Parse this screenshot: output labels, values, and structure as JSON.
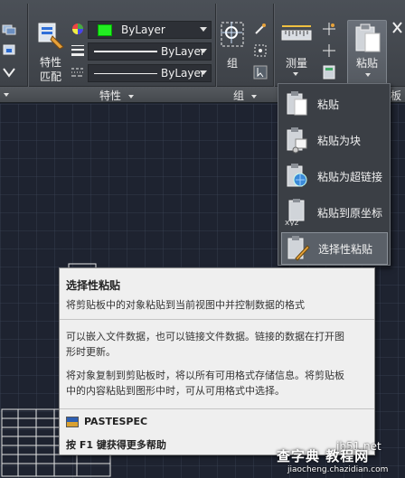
{
  "ribbon": {
    "match_properties_label": "特性\n匹配",
    "match_properties_line1": "特性",
    "match_properties_line2": "匹配",
    "color_value": "ByLayer",
    "linetype_value": "ByLayer",
    "lineweight_value": "ByLayer",
    "group_label": "组",
    "measure_label": "测量",
    "paste_label": "粘贴",
    "panels": {
      "properties": "特性",
      "groups": "组",
      "clipboard_partial": "板"
    }
  },
  "paste_menu": {
    "items": [
      {
        "label": "粘贴",
        "icon": "paste-icon"
      },
      {
        "label": "粘贴为块",
        "icon": "paste-as-block-icon"
      },
      {
        "label": "粘贴为超链接",
        "icon": "paste-as-hyperlink-icon"
      },
      {
        "label": "粘贴到原坐标",
        "icon": "paste-to-original-coordinates-icon"
      },
      {
        "label": "选择性粘贴",
        "icon": "paste-special-icon"
      }
    ]
  },
  "tooltip": {
    "title": "选择性粘贴",
    "para1": "将剪贴板中的对象粘贴到当前视图中并控制数据的格式",
    "para2_line1": "可以嵌入文件数据，也可以链接文件数据。链接的数据在打开图",
    "para2_line2": "形时更新。",
    "para3_line1": "将对象复制到剪贴板时，将以所有可用格式存储信息。将剪贴板",
    "para3_line2": "中的内容粘贴到图形中时，可从可用格式中选择。",
    "command": "PASTESPEC",
    "help": "按 F1 键获得更多帮助"
  },
  "watermark": {
    "site": "jb51.net",
    "name": "查字典 教程网",
    "url": "jiaocheng.chazidian.com"
  },
  "colors": {
    "ribbon_bg": "#43474d",
    "canvas_bg": "#1e2330",
    "color_swatch": "#22ee22",
    "tooltip_bg": "#efefef",
    "menu_bg": "#3b3f45"
  }
}
